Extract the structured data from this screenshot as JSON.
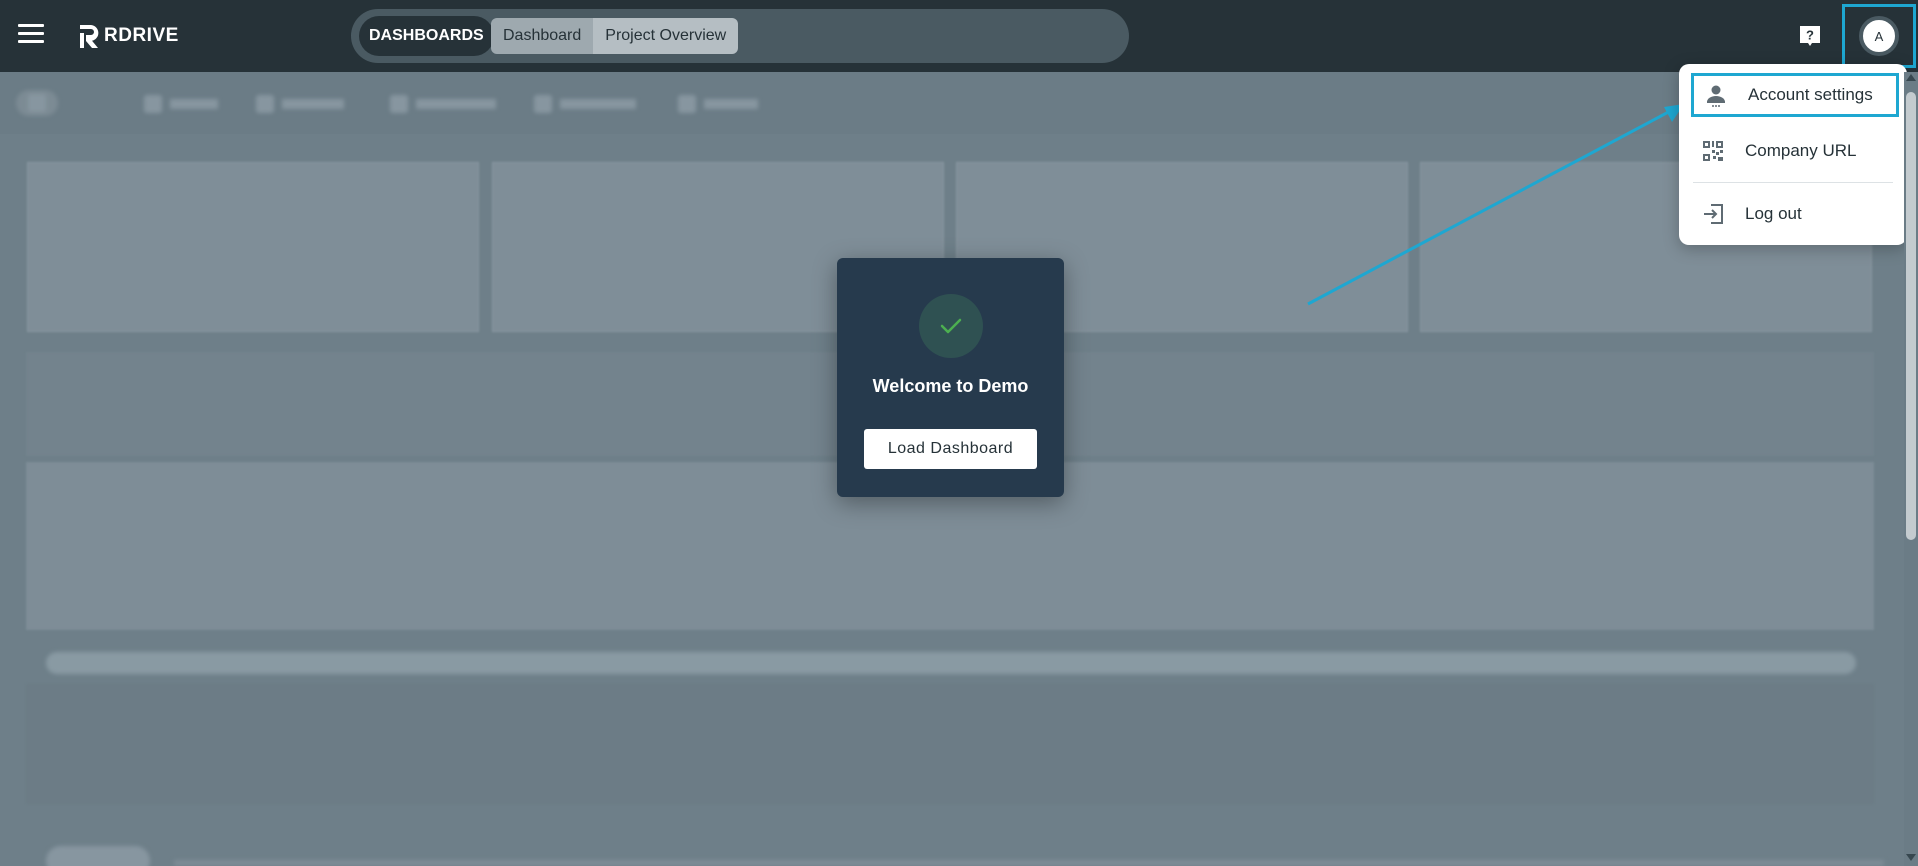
{
  "app": {
    "logo_text": "RDRIVE"
  },
  "header": {
    "section_label": "DASHBOARDS",
    "tabs": [
      {
        "label": "Dashboard"
      },
      {
        "label": "Project Overview"
      }
    ],
    "avatar_initial": "A",
    "icons": {
      "menu": "hamburger-icon",
      "help": "help-icon"
    }
  },
  "modal": {
    "title": "Welcome to Demo",
    "button_label": "Load Dashboard",
    "icon": "check-icon",
    "accent_color": "#4caf50"
  },
  "account_menu": {
    "items": [
      {
        "label": "Account settings",
        "icon": "person-icon"
      },
      {
        "label": "Company URL",
        "icon": "qr-code-icon"
      },
      {
        "label": "Log out",
        "icon": "logout-icon"
      }
    ]
  },
  "colors": {
    "header_bg": "#263238",
    "highlight": "#1ea7d1",
    "modal_bg": "#263a4d"
  }
}
